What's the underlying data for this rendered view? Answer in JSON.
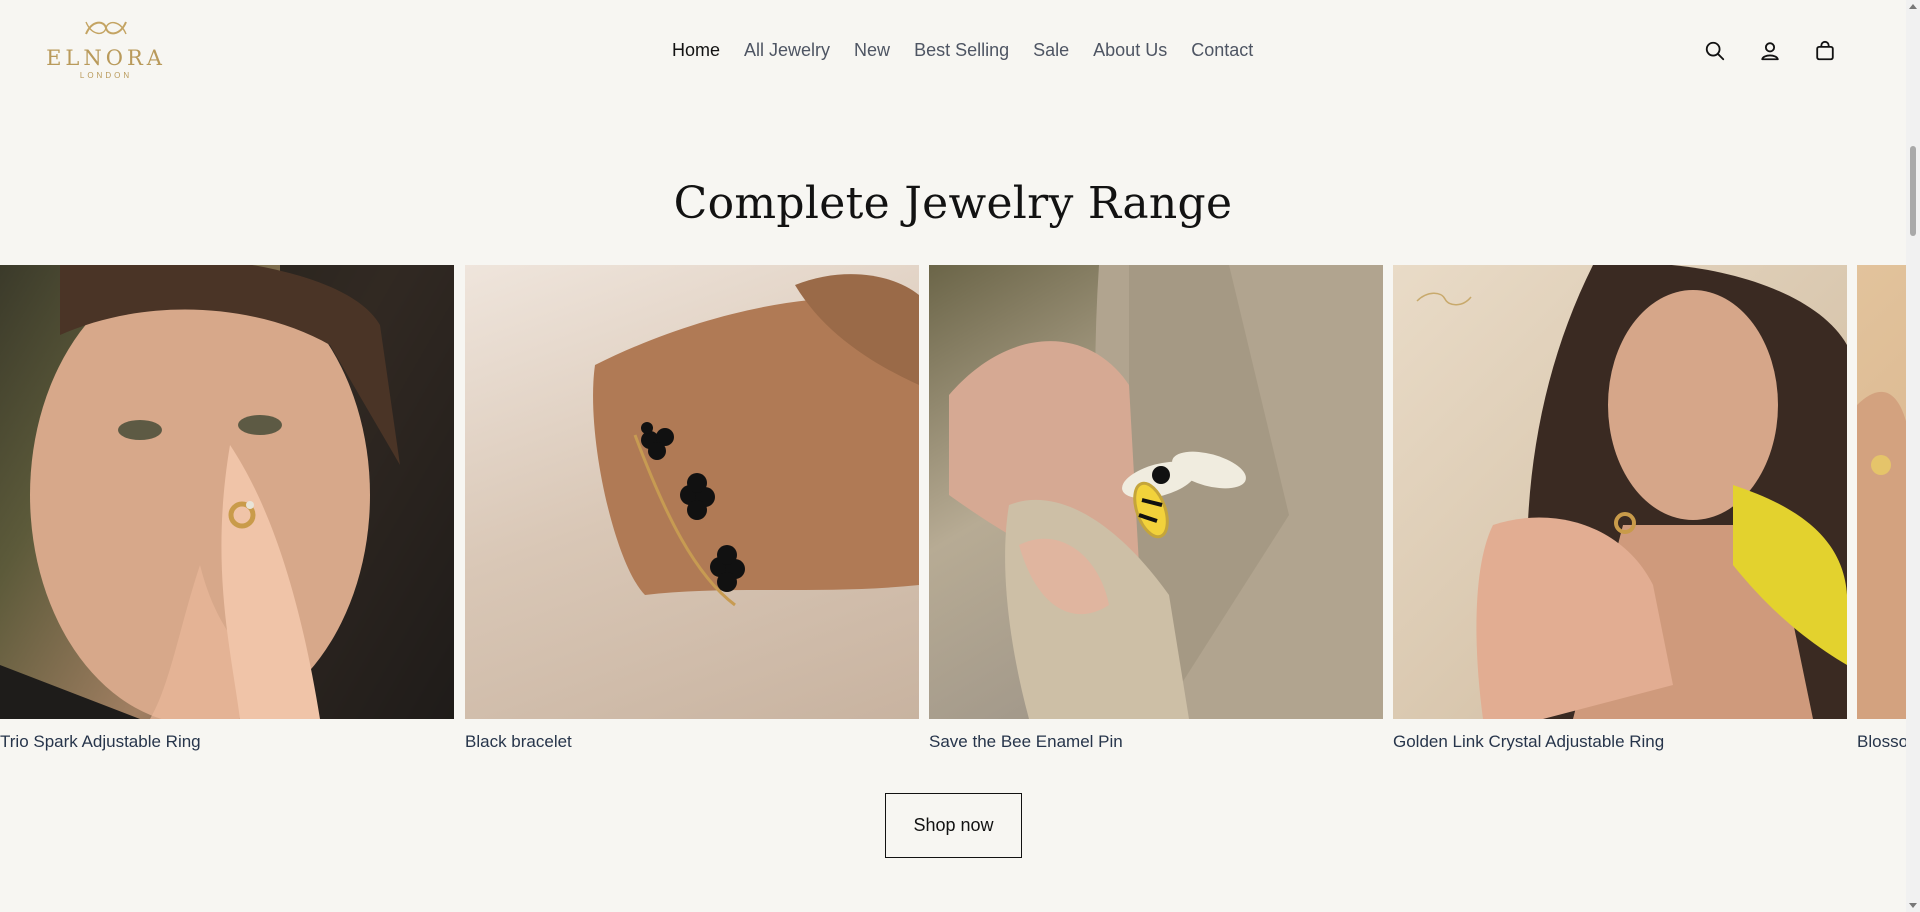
{
  "brand": {
    "name": "ELNORA",
    "sub": "LONDON",
    "color": "#b99a5b"
  },
  "nav": {
    "items": [
      {
        "label": "Home",
        "active": true
      },
      {
        "label": "All Jewelry"
      },
      {
        "label": "New"
      },
      {
        "label": "Best Selling"
      },
      {
        "label": "Sale"
      },
      {
        "label": "About Us"
      },
      {
        "label": "Contact"
      }
    ]
  },
  "header_icons": [
    "search-icon",
    "account-icon",
    "cart-icon"
  ],
  "section": {
    "title": "Complete Jewelry Range",
    "products": [
      {
        "name": "Trio Spark Adjustable Ring"
      },
      {
        "name": "Black bracelet"
      },
      {
        "name": "Save the Bee Enamel Pin"
      },
      {
        "name": "Golden Link Crystal Adjustable Ring"
      },
      {
        "name": "Blosso"
      }
    ],
    "cta": "Shop now"
  },
  "colors": {
    "background": "#f7f6f2",
    "text": "#121212",
    "caption": "#27354b"
  }
}
